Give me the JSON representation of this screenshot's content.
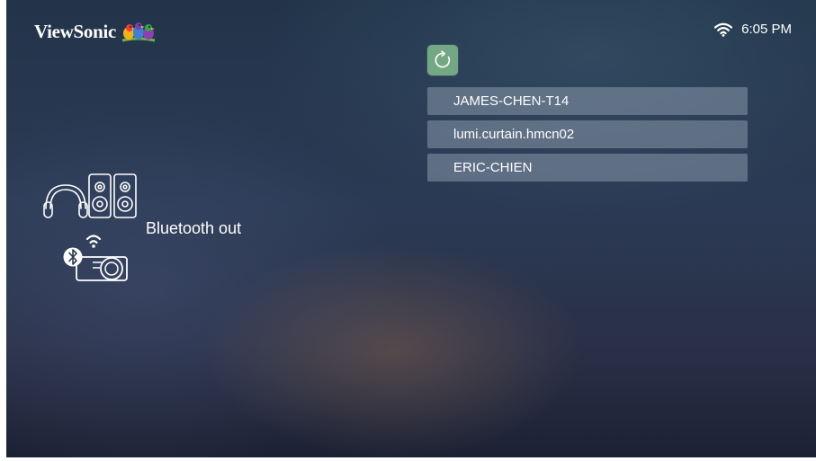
{
  "header": {
    "brand": "ViewSonic",
    "time": "6:05 PM"
  },
  "icons": {
    "brand_logo": "viewsonic-birds-logo",
    "wifi": "wifi-icon",
    "refresh": "refresh-icon",
    "headphones": "headphones-icon",
    "speakers": "speakers-icon",
    "projector": "bluetooth-projector-icon"
  },
  "colors": {
    "refresh_button": "#74a884",
    "list_item_bg": "#91a0b2"
  },
  "devices": [
    {
      "name": "JAMES-CHEN-T14"
    },
    {
      "name": "lumi.curtain.hmcn02"
    },
    {
      "name": "ERIC-CHIEN"
    }
  ],
  "mode": {
    "label": "Bluetooth out"
  }
}
